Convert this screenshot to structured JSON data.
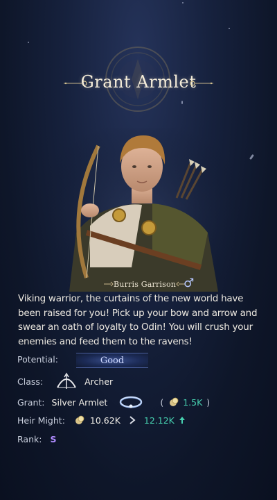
{
  "title": "Grant Armlet",
  "hero": {
    "name": "Burris Garrison",
    "gender_symbol": "♂"
  },
  "story": "Viking warrior, the curtains of the new world have been raised for you! Pick up your bow and arrow and swear an oath of loyalty to Odin! You will crush your enemies and feed them to the ravens!",
  "stats": {
    "potential_label": "Potential:",
    "potential_value": "Good",
    "class_label": "Class:",
    "class_value": "Archer",
    "grant_label": "Grant:",
    "grant_value": "Silver Armlet",
    "grant_open": "(",
    "grant_amount": "1.5K",
    "grant_close": ")",
    "heir_label": "Heir Might:",
    "heir_from": "10.62K",
    "heir_to": "12.12K",
    "rank_label": "Rank:",
    "rank_value": "S"
  },
  "icons": {
    "class": "bow-icon",
    "grant_item": "armlet-icon",
    "currency": "might-coin-icon",
    "arrow": "arrow-right-icon",
    "increase": "increase-arrow-icon"
  },
  "colors": {
    "background": "#16213d",
    "increase": "#47d1b0",
    "rank_s": "#b08cff",
    "potential": "#cfd9ff"
  }
}
